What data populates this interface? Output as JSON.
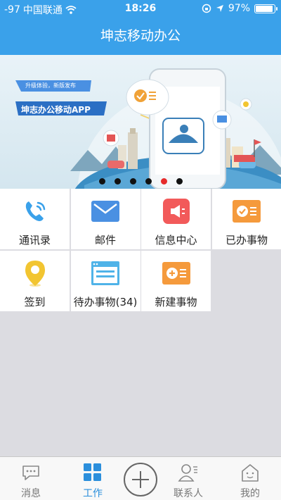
{
  "status_bar": {
    "signal": "-97",
    "carrier": "中国联通",
    "time": "18:26",
    "battery_percent": "97%",
    "battery_level": 0.97
  },
  "nav": {
    "title": "坤志移动办公"
  },
  "banner": {
    "tagline": "升级体验，新版发布",
    "headline": "坤志办公移动APP",
    "page_count": 6,
    "active_page": 4
  },
  "grid": {
    "items": [
      {
        "label": "通讯录",
        "icon": "phone-icon",
        "color": "#3aa1ea"
      },
      {
        "label": "邮件",
        "icon": "mail-icon",
        "color": "#4a90e2"
      },
      {
        "label": "信息中心",
        "icon": "megaphone-icon",
        "color": "#f25a5a"
      },
      {
        "label": "已办事物",
        "icon": "done-list-icon",
        "color": "#f59a3c"
      },
      {
        "label": "签到",
        "icon": "location-pin-icon",
        "color": "#f2c531"
      },
      {
        "label": "待办事物(34)",
        "icon": "todo-window-icon",
        "color": "#4fb3e8"
      },
      {
        "label": "新建事物",
        "icon": "new-item-icon",
        "color": "#f59a3c"
      }
    ]
  },
  "tabbar": {
    "items": [
      {
        "label": "消息",
        "icon": "chat-bubble-icon"
      },
      {
        "label": "工作",
        "icon": "grid-icon",
        "active": true
      },
      {
        "label": "",
        "icon": "plus-icon"
      },
      {
        "label": "联系人",
        "icon": "contacts-icon"
      },
      {
        "label": "我的",
        "icon": "house-face-icon"
      }
    ]
  }
}
